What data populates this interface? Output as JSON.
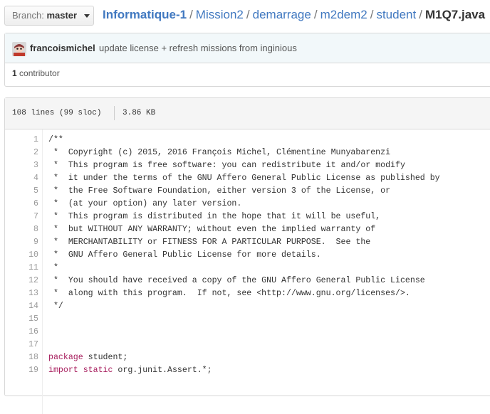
{
  "header": {
    "branch_label": "Branch:",
    "branch_value": "master",
    "breadcrumb": [
      "Informatique-1",
      "Mission2",
      "demarrage",
      "m2dem2",
      "student"
    ],
    "file_name": "M1Q7.java"
  },
  "commit": {
    "author": "francoismichel",
    "message": "update license + refresh missions from inginious",
    "contributor_count": "1",
    "contributor_label": "contributor"
  },
  "file": {
    "lines_info": "108 lines (99 sloc)",
    "size": "3.86 KB"
  },
  "code": {
    "lines": [
      {
        "n": "1",
        "t": "/**",
        "k": "cmt"
      },
      {
        "n": "2",
        "t": " *  Copyright (c) 2015, 2016 François Michel, Clémentine Munyabarenzi",
        "k": "cmt"
      },
      {
        "n": "3",
        "t": " *  This program is free software: you can redistribute it and/or modify",
        "k": "cmt"
      },
      {
        "n": "4",
        "t": " *  it under the terms of the GNU Affero General Public License as published by",
        "k": "cmt"
      },
      {
        "n": "5",
        "t": " *  the Free Software Foundation, either version 3 of the License, or",
        "k": "cmt"
      },
      {
        "n": "6",
        "t": " *  (at your option) any later version.",
        "k": "cmt"
      },
      {
        "n": "7",
        "t": " *  This program is distributed in the hope that it will be useful,",
        "k": "cmt"
      },
      {
        "n": "8",
        "t": " *  but WITHOUT ANY WARRANTY; without even the implied warranty of",
        "k": "cmt"
      },
      {
        "n": "9",
        "t": " *  MERCHANTABILITY or FITNESS FOR A PARTICULAR PURPOSE.  See the",
        "k": "cmt"
      },
      {
        "n": "10",
        "t": " *  GNU Affero General Public License for more details.",
        "k": "cmt"
      },
      {
        "n": "11",
        "t": " *",
        "k": "cmt"
      },
      {
        "n": "12",
        "t": " *  You should have received a copy of the GNU Affero General Public License",
        "k": "cmt"
      },
      {
        "n": "13",
        "t": " *  along with this program.  If not, see <http://www.gnu.org/licenses/>.",
        "k": "cmt"
      },
      {
        "n": "14",
        "t": " */",
        "k": "cmt"
      },
      {
        "n": "15",
        "t": "",
        "k": ""
      },
      {
        "n": "16",
        "t": "",
        "k": ""
      },
      {
        "n": "17",
        "t": "",
        "k": ""
      },
      {
        "n": "18",
        "kw": "package",
        "t": " student;",
        "k": "pkg"
      },
      {
        "n": "19",
        "kw": "import static",
        "t": " org.junit.Assert.*;",
        "k": "pkg"
      }
    ]
  }
}
